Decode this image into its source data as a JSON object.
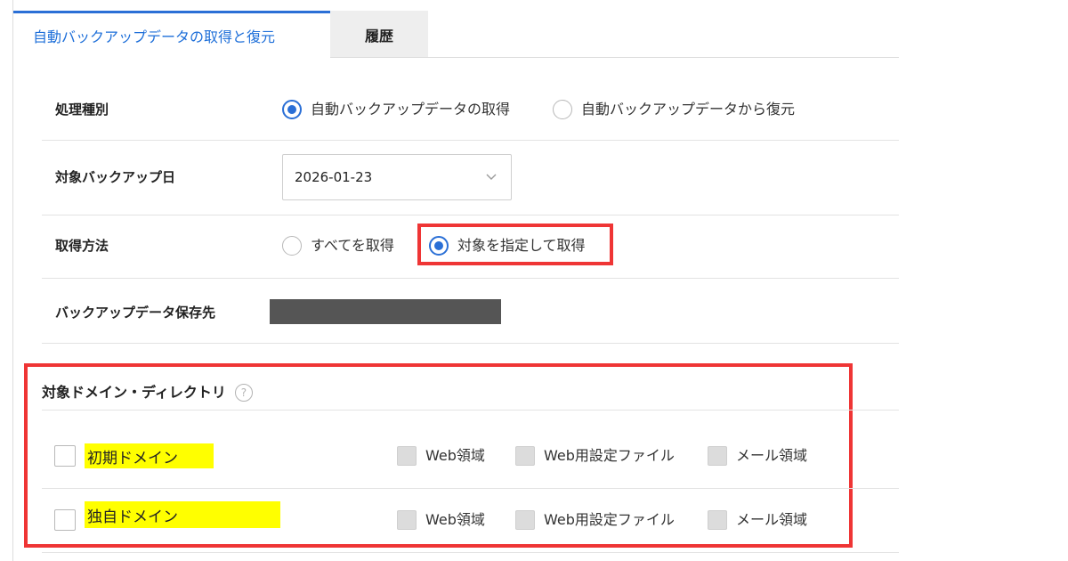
{
  "tabs": [
    {
      "label": "自動バックアップデータの取得と復元",
      "active": true
    },
    {
      "label": "履歴",
      "active": false
    }
  ],
  "form": {
    "process_type": {
      "label": "処理種別",
      "options": [
        {
          "label": "自動バックアップデータの取得",
          "selected": true
        },
        {
          "label": "自動バックアップデータから復元",
          "selected": false
        }
      ]
    },
    "backup_date": {
      "label": "対象バックアップ日",
      "value": "2026-01-23"
    },
    "method": {
      "label": "取得方法",
      "options": [
        {
          "label": "すべてを取得",
          "selected": false
        },
        {
          "label": "対象を指定して取得",
          "selected": true
        }
      ]
    },
    "destination": {
      "label": "バックアップデータ保存先",
      "value_redacted": true
    }
  },
  "target_section": {
    "title": "対象ドメイン・ディレクトリ",
    "help_symbol": "?",
    "domains": [
      {
        "name": "初期ドメイン",
        "checked": false,
        "areas": [
          "Web領域",
          "Web用設定ファイル",
          "メール領域"
        ]
      },
      {
        "name": "独自ドメイン",
        "checked": false,
        "areas": [
          "Web領域",
          "Web用設定ファイル",
          "メール領域"
        ]
      }
    ]
  },
  "colors": {
    "accent": "#2a6fd6",
    "highlight_box": "#ef3535",
    "domain_highlight": "#ffff00",
    "redaction": "#555555"
  },
  "icons": {
    "select_chevron": "chevron-down-icon",
    "help": "help-circle-icon"
  }
}
